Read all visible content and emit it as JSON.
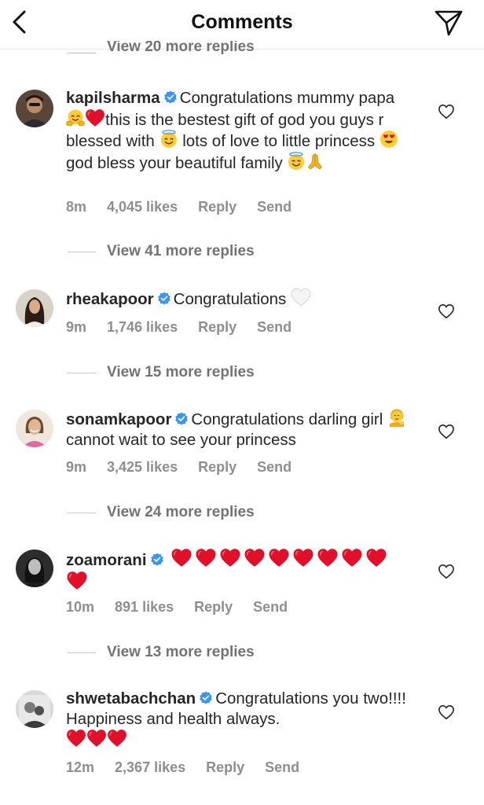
{
  "header": {
    "title": "Comments"
  },
  "top_replies": "View 20 more replies",
  "comments": [
    {
      "username": "kapilsharma",
      "text_parts": [
        "Congratulations mummy papa ",
        "this is the bestest gift of god you guys r blessed with ",
        " lots of love to little princess ",
        "god bless your beautiful family "
      ],
      "time": "8m",
      "likes": "4,045 likes",
      "reply": "Reply",
      "send": "Send",
      "view_replies": "View 41 more replies"
    },
    {
      "username": "rheakapoor",
      "text_parts": [
        "Congratulations "
      ],
      "time": "9m",
      "likes": "1,746 likes",
      "reply": "Reply",
      "send": "Send",
      "view_replies": "View 15 more replies"
    },
    {
      "username": "sonamkapoor",
      "text_parts": [
        "Congratulations darling girl ",
        " cannot wait to see your princess"
      ],
      "time": "9m",
      "likes": "3,425 likes",
      "reply": "Reply",
      "send": "Send",
      "view_replies": "View 24 more replies"
    },
    {
      "username": "zoamorani",
      "text_parts": [],
      "time": "10m",
      "likes": "891 likes",
      "reply": "Reply",
      "send": "Send",
      "view_replies": "View 13 more replies"
    },
    {
      "username": "shwetabachchan",
      "text_parts": [
        "Congratulations you two!!!! Happiness and health always."
      ],
      "time": "12m",
      "likes": "2,367 likes",
      "reply": "Reply",
      "send": "Send"
    }
  ],
  "colors": {
    "verified": "#3897f0",
    "heart_red": "#e0102a",
    "meta_gray": "#8e8e8e"
  },
  "icons": [
    "back-arrow-icon",
    "direct-send-icon",
    "verified-badge-icon",
    "like-heart-icon",
    "red-heart-emoji",
    "smiling-face-with-halo-emoji",
    "hugging-face-emoji",
    "heart-eyes-emoji",
    "folded-hands-emoji",
    "white-heart-emoji",
    "person-tipping-hand-emoji"
  ]
}
